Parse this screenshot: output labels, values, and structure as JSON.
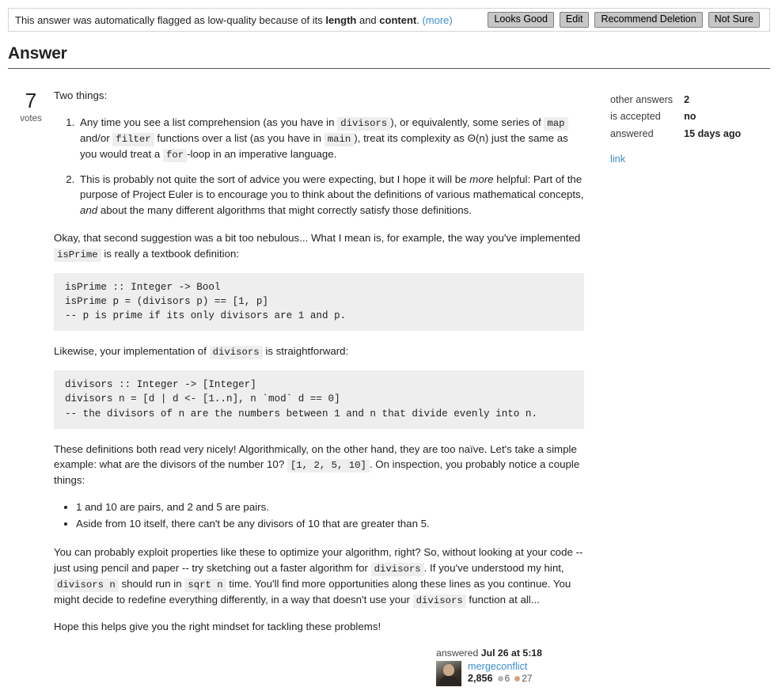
{
  "flag_banner": {
    "text_pre": "This answer was automatically flagged as low-quality because of its ",
    "reason_1": "length",
    "text_mid": " and ",
    "reason_2": "content",
    "text_post": ". ",
    "more_label": "(more)",
    "buttons": [
      {
        "label": "Looks Good"
      },
      {
        "label": "Edit"
      },
      {
        "label": "Recommend Deletion"
      },
      {
        "label": "Not Sure"
      }
    ]
  },
  "section": {
    "heading": "Answer"
  },
  "vote": {
    "count": "7",
    "label": "votes"
  },
  "post": {
    "intro": "Two things:",
    "numbered": {
      "item1": {
        "a": "Any time you see a list comprehension (as you have in ",
        "code1": "divisors",
        "b": "), or equivalently, some series of ",
        "code2": "map",
        "c": " and/or ",
        "code3": "filter",
        "d": " functions over a list (as you have in ",
        "code4": "main",
        "e": "), treat its complexity as Θ(n) just the same as you would treat a ",
        "code5": "for",
        "f": "-loop in an imperative language."
      },
      "item2": {
        "a": "This is probably not quite the sort of advice you were expecting, but I hope it will be ",
        "em1": "more",
        "b": " helpful: Part of the purpose of Project Euler is to encourage you to think about the definitions of various mathematical concepts, ",
        "em2": "and",
        "c": " about the many different algorithms that might correctly satisfy those definitions."
      }
    },
    "para_nebulous": {
      "a": "Okay, that second suggestion was a bit too nebulous... What I mean is, for example, the way you've implemented ",
      "code1": "isPrime",
      "b": " is really a textbook definition:"
    },
    "code_isprime": "isPrime :: Integer -> Bool\nisPrime p = (divisors p) == [1, p]\n-- p is prime if its only divisors are 1 and p.",
    "para_likewise": {
      "a": "Likewise, your implementation of ",
      "code1": "divisors",
      "b": " is straightforward:"
    },
    "code_divisors": "divisors :: Integer -> [Integer]\ndivisors n = [d | d <- [1..n], n `mod` d == 0]\n-- the divisors of n are the numbers between 1 and n that divide evenly into n.",
    "para_naive": {
      "a": "These definitions both read very nicely! Algorithmically, on the other hand, they are too naïve. Let's take a simple example: what are the divisors of the number 10? ",
      "code1": "[1, 2, 5, 10]",
      "b": ". On inspection, you probably notice a couple things:"
    },
    "bullets": [
      "1 and 10 are pairs, and 2 and 5 are pairs.",
      "Aside from 10 itself, there can't be any divisors of 10 that are greater than 5."
    ],
    "para_exploit": {
      "a": "You can probably exploit properties like these to optimize your algorithm, right? So, without looking at your code -- just using pencil and paper -- try sketching out a faster algorithm for ",
      "code1": "divisors",
      "b": ". If you've understood my hint, ",
      "code2": "divisors n",
      "c": " should run in ",
      "code3": "sqrt n",
      "d": " time. You'll find more opportunities along these lines as you continue. You might decide to redefine everything differently, in a way that doesn't use your ",
      "code4": "divisors",
      "e": " function at all..."
    },
    "para_hope": "Hope this helps give you the right mindset for tackling these problems!"
  },
  "stats": {
    "rows": [
      {
        "key": "other answers",
        "value": "2"
      },
      {
        "key": "is accepted",
        "value": "no"
      },
      {
        "key": "answered",
        "value": "15 days ago"
      }
    ],
    "link_label": "link"
  },
  "signature": {
    "action": "answered",
    "timestamp": "Jul 26 at 5:18",
    "username": "mergeconflict",
    "reputation": "2,856",
    "silver_badges": "6",
    "bronze_badges": "27"
  },
  "colors": {
    "link": "#3b8ed0",
    "code_bg": "#eeeeee",
    "button_bg": "#c6c6c6",
    "silver_badge": "#b4b8bc",
    "bronze_badge": "#d1a684"
  }
}
